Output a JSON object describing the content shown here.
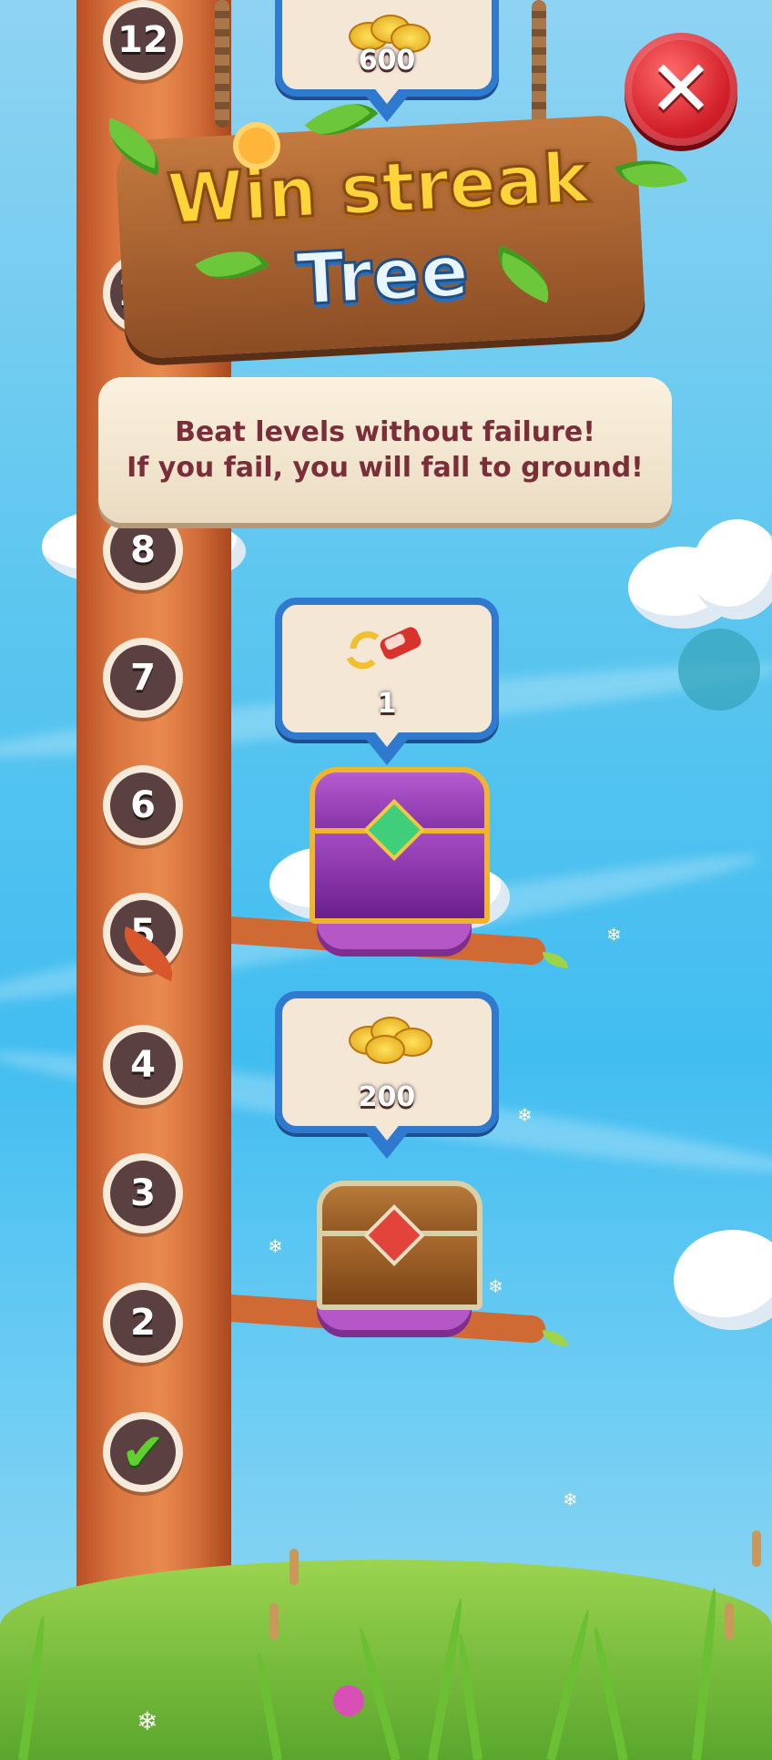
{
  "game": {
    "title_line1": "Win streak",
    "title_line2": "Tree",
    "description_line1": "Beat levels without failure!",
    "description_line2": "If you fail, you will fall to ground!",
    "close_icon": "close-icon"
  },
  "levels": [
    {
      "label": "12"
    },
    {
      "label": "10"
    },
    {
      "label": "8"
    },
    {
      "label": "7"
    },
    {
      "label": "6"
    },
    {
      "label": "5"
    },
    {
      "label": "4"
    },
    {
      "label": "3"
    },
    {
      "label": "2"
    },
    {
      "label": "",
      "completed": true,
      "icon": "checkmark-icon"
    }
  ],
  "rewards": [
    {
      "icon": "coins-icon",
      "value": "600",
      "chest": "none"
    },
    {
      "icon": "car-swap-icon",
      "value": "1",
      "chest": "purple-chest"
    },
    {
      "icon": "coins-icon",
      "value": "200",
      "chest": "wooden-chest"
    }
  ],
  "colors": {
    "sky": "#42bdf0",
    "trunk": "#d9743f",
    "bubble_border": "#2f79cf",
    "close_button": "#d21f2a",
    "text_dark": "#7a2e3a",
    "check": "#5fd02f"
  }
}
